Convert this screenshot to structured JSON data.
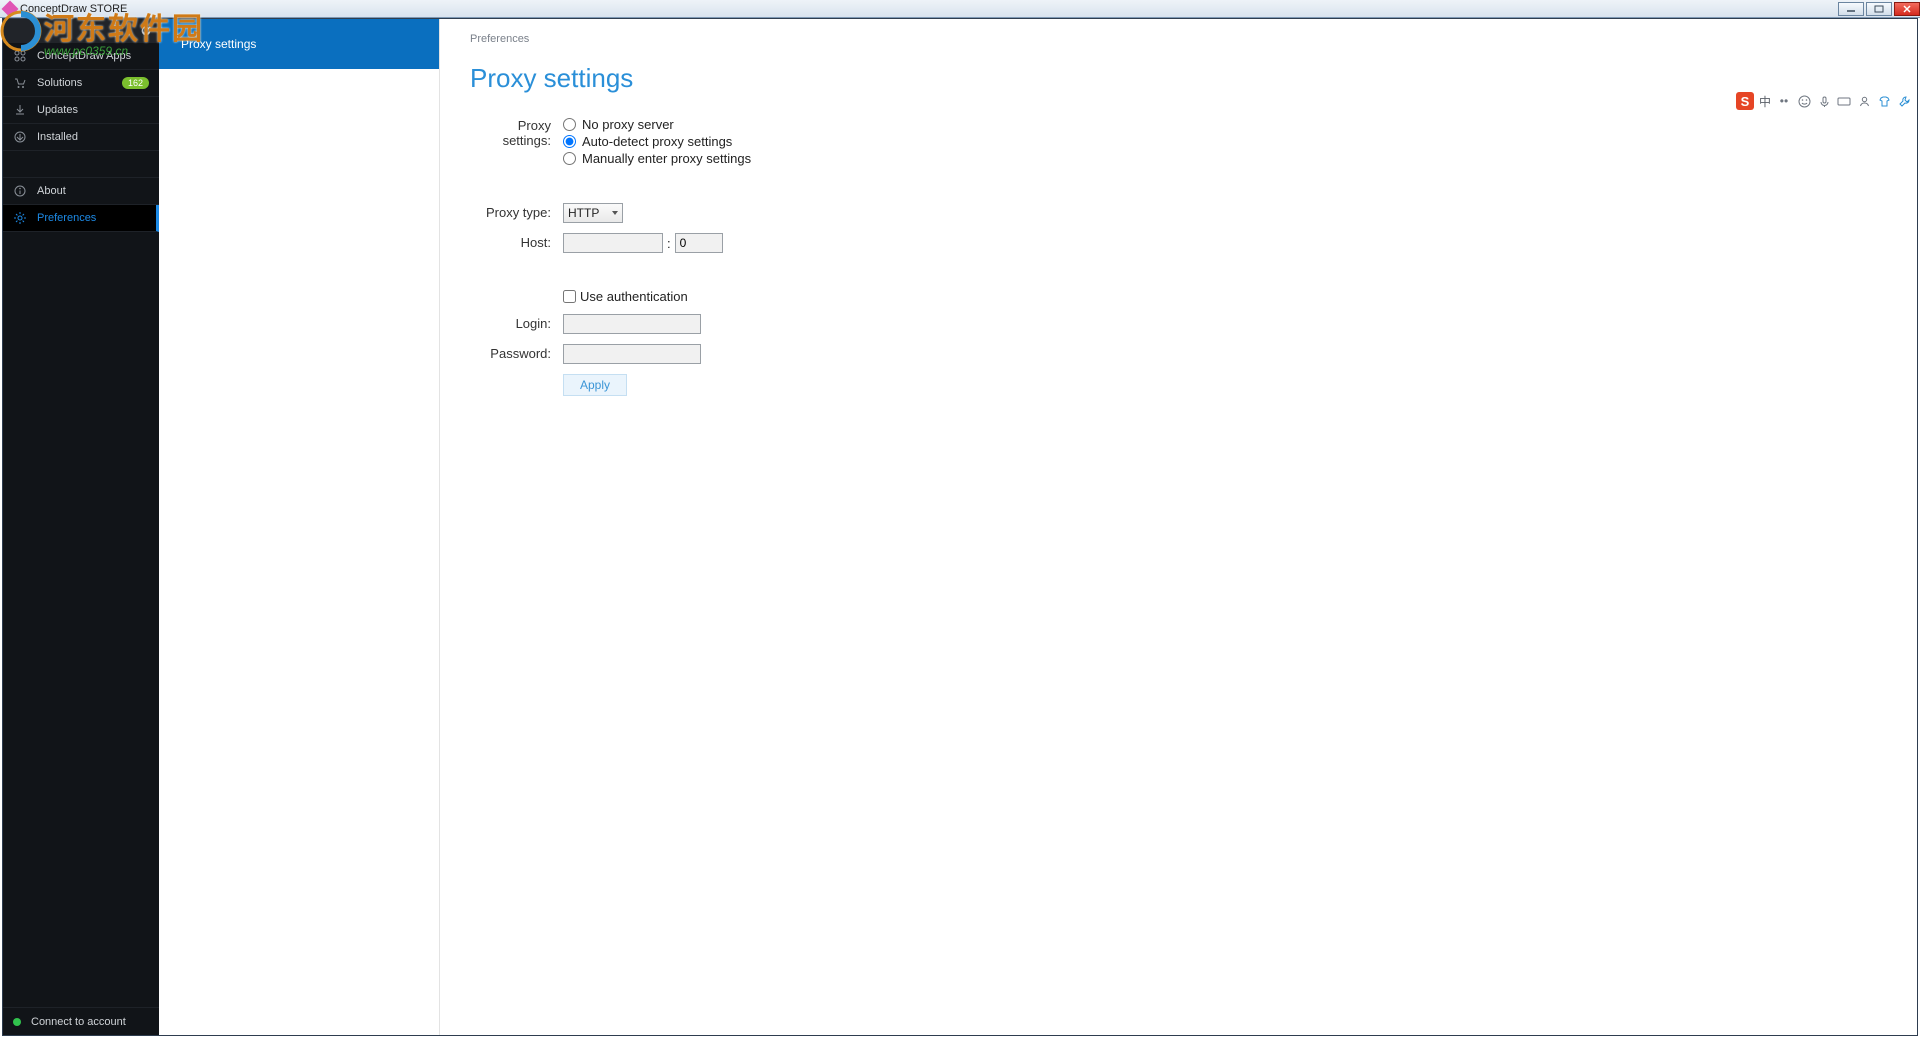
{
  "window": {
    "title": "ConceptDraw STORE"
  },
  "watermark": {
    "cn": "河东软件园",
    "en": "www.pc0359.cn"
  },
  "sidebar": {
    "brand_refresh_tooltip": "Refresh",
    "items": [
      {
        "icon": "apps",
        "label": "ConceptDraw Apps"
      },
      {
        "icon": "cart",
        "label": "Solutions",
        "badge": "162"
      },
      {
        "icon": "download",
        "label": "Updates"
      },
      {
        "icon": "installed",
        "label": "Installed"
      }
    ],
    "items2": [
      {
        "icon": "info",
        "label": "About"
      },
      {
        "icon": "gear",
        "label": "Preferences",
        "active": true
      }
    ],
    "footer": {
      "label": "Connect to account"
    }
  },
  "subnav": {
    "active_label": "Proxy settings"
  },
  "main": {
    "breadcrumb": "Preferences",
    "title": "Proxy settings",
    "proxy_label_1": "Proxy",
    "proxy_label_2": "settings:",
    "opt_none": "No proxy server",
    "opt_auto": "Auto-detect proxy settings",
    "opt_manual": "Manually enter proxy settings",
    "type_label": "Proxy type:",
    "type_value": "HTTP",
    "host_label": "Host:",
    "host_value": "",
    "port_value": "0",
    "auth_label": "Use authentication",
    "login_label": "Login:",
    "login_value": "",
    "password_label": "Password:",
    "password_value": "",
    "apply_label": "Apply"
  },
  "float_toolbar": {
    "zh": "中"
  }
}
